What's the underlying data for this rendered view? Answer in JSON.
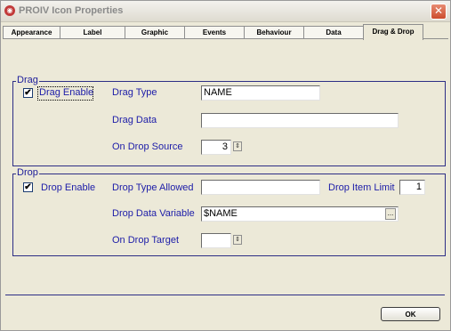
{
  "window": {
    "title": "PROIV Icon Properties",
    "close_glyph": "✕"
  },
  "tabs": [
    {
      "label": "Appearance"
    },
    {
      "label": "Label"
    },
    {
      "label": "Graphic"
    },
    {
      "label": "Events"
    },
    {
      "label": "Behaviour"
    },
    {
      "label": "Data"
    },
    {
      "label": "Drag & Drop"
    }
  ],
  "drag": {
    "legend": "Drag",
    "enable_label": "Drag Enable",
    "enable_checked": true,
    "type_label": "Drag Type",
    "type_value": "NAME",
    "data_label": "Drag Data",
    "data_value": "",
    "source_label": "On Drop Source",
    "source_value": "3"
  },
  "drop": {
    "legend": "Drop",
    "enable_label": "Drop Enable",
    "enable_checked": true,
    "type_label": "Drop Type Allowed",
    "type_value": "",
    "limit_label": "Drop Item Limit",
    "limit_value": "1",
    "variable_label": "Drop Data Variable",
    "variable_value": "$NAME",
    "target_label": "On Drop Target",
    "target_value": ""
  },
  "buttons": {
    "ok": "OK",
    "ellipsis": "...",
    "spin": "⇕",
    "check": "✔"
  }
}
